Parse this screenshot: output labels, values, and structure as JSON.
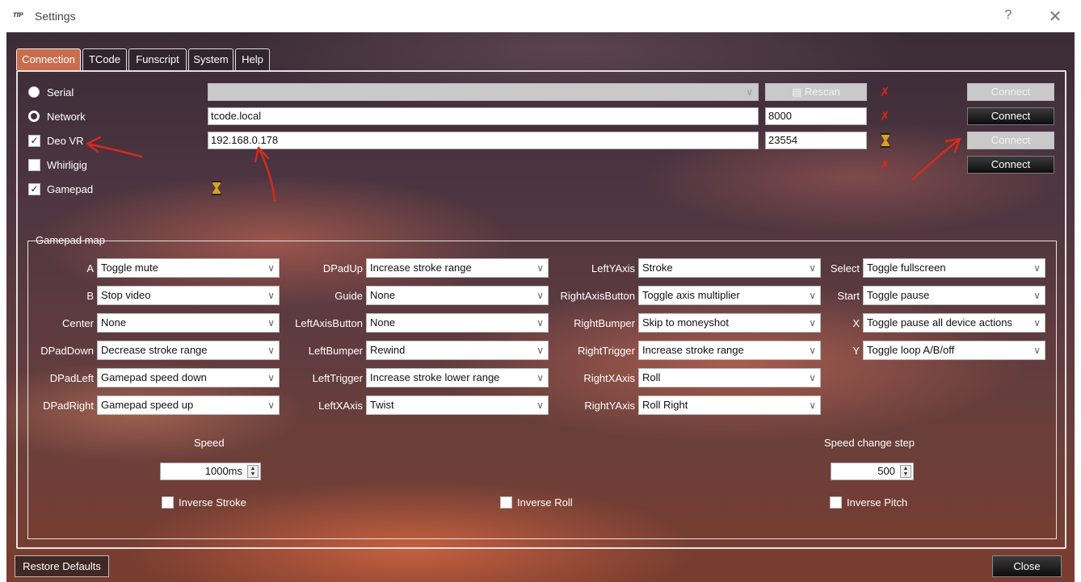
{
  "window": {
    "app_icon": "ᴛᴛᴘ",
    "title": "Settings",
    "help": "?",
    "close": "✕"
  },
  "tabs": [
    {
      "label": "Connection",
      "active": true
    },
    {
      "label": "TCode"
    },
    {
      "label": "Funscript"
    },
    {
      "label": "System"
    },
    {
      "label": "Help"
    }
  ],
  "connection": {
    "serial_label": "Serial",
    "network_label": "Network",
    "deovr_label": "Deo VR",
    "whirligig_label": "Whirligig",
    "gamepad_label": "Gamepad",
    "deovr_checked": true,
    "whirligig_checked": false,
    "gamepad_checked": true,
    "serial_port_value": "",
    "rescan_label": "Rescan",
    "network_host": "tcode.local",
    "network_port": "8000",
    "deovr_host": "192.168.0.178",
    "deovr_port": "23554",
    "connect_label": "Connect",
    "status_colors": {
      "error": "#e2231a",
      "waiting": "#d9a420"
    }
  },
  "gamepad_map": {
    "title": "Gamepad map",
    "columns": [
      [
        {
          "label": "A",
          "value": "Toggle mute"
        },
        {
          "label": "B",
          "value": "Stop video"
        },
        {
          "label": "Center",
          "value": "None"
        },
        {
          "label": "DPadDown",
          "value": "Decrease stroke range"
        },
        {
          "label": "DPadLeft",
          "value": "Gamepad speed down"
        },
        {
          "label": "DPadRight",
          "value": "Gamepad speed up"
        }
      ],
      [
        {
          "label": "DPadUp",
          "value": "Increase stroke range"
        },
        {
          "label": "Guide",
          "value": "None"
        },
        {
          "label": "LeftAxisButton",
          "value": "None"
        },
        {
          "label": "LeftBumper",
          "value": "Rewind"
        },
        {
          "label": "LeftTrigger",
          "value": "Increase stroke lower range"
        },
        {
          "label": "LeftXAxis",
          "value": "Twist"
        }
      ],
      [
        {
          "label": "LeftYAxis",
          "value": "Stroke"
        },
        {
          "label": "RightAxisButton",
          "value": "Toggle axis multiplier"
        },
        {
          "label": "RightBumper",
          "value": "Skip to moneyshot"
        },
        {
          "label": "RightTrigger",
          "value": "Increase stroke range"
        },
        {
          "label": "RightXAxis",
          "value": "Roll"
        },
        {
          "label": "RightYAxis",
          "value": "Roll Right"
        }
      ],
      [
        {
          "label": "Select",
          "value": "Toggle fullscreen"
        },
        {
          "label": "Start",
          "value": "Toggle pause"
        },
        {
          "label": "X",
          "value": "Toggle pause all device actions"
        },
        {
          "label": "Y",
          "value": "Toggle loop A/B/off"
        }
      ]
    ],
    "speed_label": "Speed",
    "speed_value": "1000ms",
    "speed_step_label": "Speed change step",
    "speed_step_value": "500",
    "inverse_stroke_label": "Inverse Stroke",
    "inverse_roll_label": "Inverse Roll",
    "inverse_pitch_label": "Inverse Pitch",
    "spin_up": "▲",
    "spin_down": "▼"
  },
  "footer": {
    "restore_label": "Restore Defaults",
    "close_label": "Close"
  },
  "annotation_color": "#d42a1e"
}
